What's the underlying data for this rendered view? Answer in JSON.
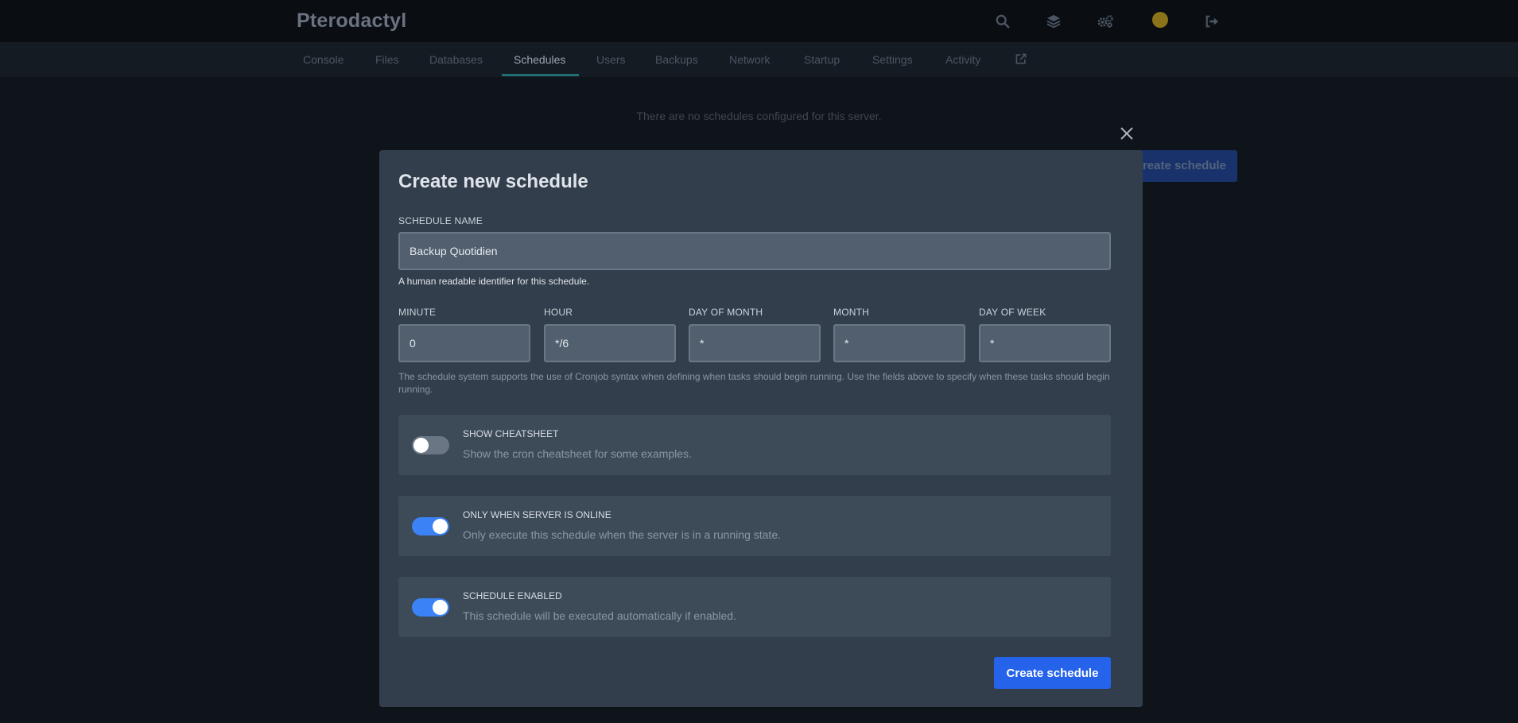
{
  "app": {
    "brand": "Pterodactyl"
  },
  "topbar": {
    "icons": [
      "search-icon",
      "layers-icon",
      "gears-icon",
      "avatar",
      "sign-out-icon"
    ]
  },
  "nav": {
    "tabs": [
      {
        "label": "Console"
      },
      {
        "label": "Files"
      },
      {
        "label": "Databases"
      },
      {
        "label": "Schedules",
        "active": true
      },
      {
        "label": "Users"
      },
      {
        "label": "Backups"
      },
      {
        "label": "Network"
      },
      {
        "label": "Startup"
      },
      {
        "label": "Settings"
      },
      {
        "label": "Activity"
      }
    ],
    "external_icon": "external-link-icon"
  },
  "page": {
    "empty_message": "There are no schedules configured for this server.",
    "create_button_label": "Create schedule"
  },
  "modal": {
    "title": "Create new schedule",
    "name_field": {
      "label": "Schedule Name",
      "value": "Backup Quotidien",
      "help": "A human readable identifier for this schedule."
    },
    "cron": {
      "minute": {
        "label": "Minute",
        "value": "0"
      },
      "hour": {
        "label": "Hour",
        "value": "*/6"
      },
      "day_of_month": {
        "label": "Day of Month",
        "value": "*"
      },
      "month": {
        "label": "Month",
        "value": "*"
      },
      "day_of_week": {
        "label": "Day of Week",
        "value": "*"
      },
      "help": "The schedule system supports the use of Cronjob syntax when defining when tasks should begin running. Use the fields above to specify when these tasks should begin running."
    },
    "toggles": {
      "cheatsheet": {
        "title": "Show Cheatsheet",
        "description": "Show the cron cheatsheet for some examples.",
        "on": false
      },
      "only_online": {
        "title": "Only When Server Is Online",
        "description": "Only execute this schedule when the server is in a running state.",
        "on": true
      },
      "enabled": {
        "title": "Schedule Enabled",
        "description": "This schedule will be executed automatically if enabled.",
        "on": true
      }
    },
    "submit_label": "Create schedule"
  },
  "colors": {
    "accent": "#2563eb",
    "toggle_on": "#3b82f6",
    "modal_bg": "#323e4b"
  }
}
